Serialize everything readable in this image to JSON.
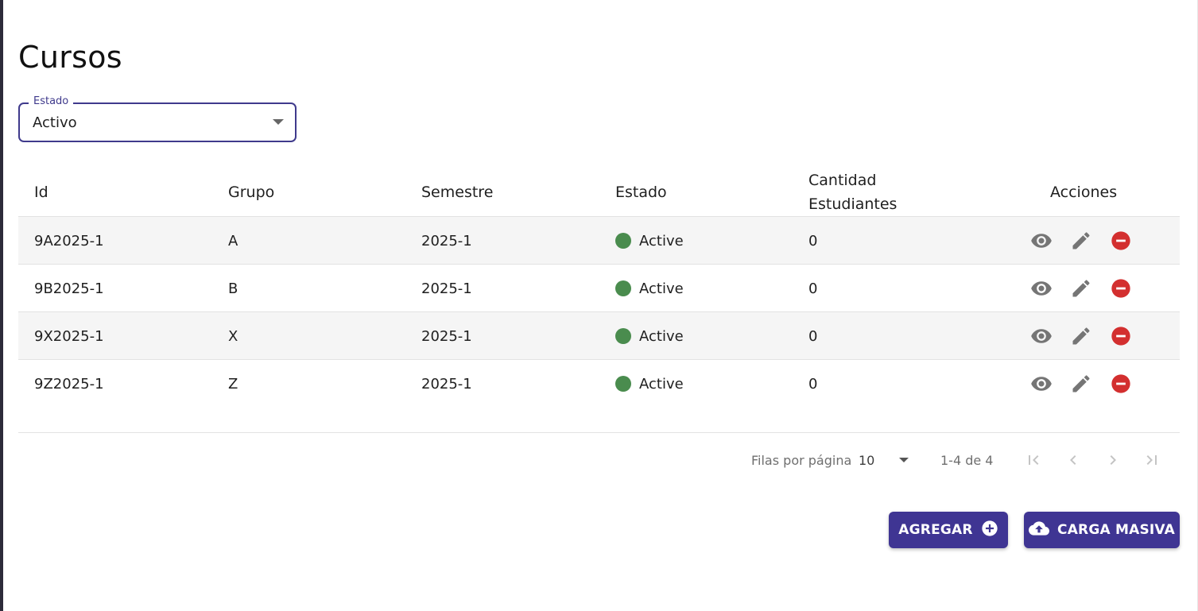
{
  "page": {
    "title": "Cursos"
  },
  "filter": {
    "label": "Estado",
    "value": "Activo"
  },
  "table": {
    "headers": {
      "id": "Id",
      "grupo": "Grupo",
      "semestre": "Semestre",
      "estado": "Estado",
      "cantidad_line1": "Cantidad",
      "cantidad_line2": "Estudiantes",
      "acciones": "Acciones"
    },
    "rows": [
      {
        "id": "9A2025-1",
        "grupo": "A",
        "semestre": "2025-1",
        "estado": "Active",
        "cantidad": "0"
      },
      {
        "id": "9B2025-1",
        "grupo": "B",
        "semestre": "2025-1",
        "estado": "Active",
        "cantidad": "0"
      },
      {
        "id": "9X2025-1",
        "grupo": "X",
        "semestre": "2025-1",
        "estado": "Active",
        "cantidad": "0"
      },
      {
        "id": "9Z2025-1",
        "grupo": "Z",
        "semestre": "2025-1",
        "estado": "Active",
        "cantidad": "0"
      }
    ]
  },
  "pagination": {
    "rows_per_page_label": "Filas por página",
    "rows_per_page": "10",
    "range": "1-4 de 4"
  },
  "buttons": {
    "add": "AGREGAR",
    "bulk": "CARGA MASIVA"
  },
  "icons": {
    "view": "eye-icon",
    "edit": "pencil-icon",
    "delete": "remove-circle-icon",
    "first": "first-page-icon",
    "prev": "chevron-left-icon",
    "next": "chevron-right-icon",
    "last": "last-page-icon",
    "add": "plus-circle-icon",
    "bulk": "cloud-upload-icon"
  },
  "colors": {
    "primary": "#3f3593",
    "status_active": "#4a8c4e",
    "delete": "#d32f2f",
    "icon_gray": "#757575"
  }
}
